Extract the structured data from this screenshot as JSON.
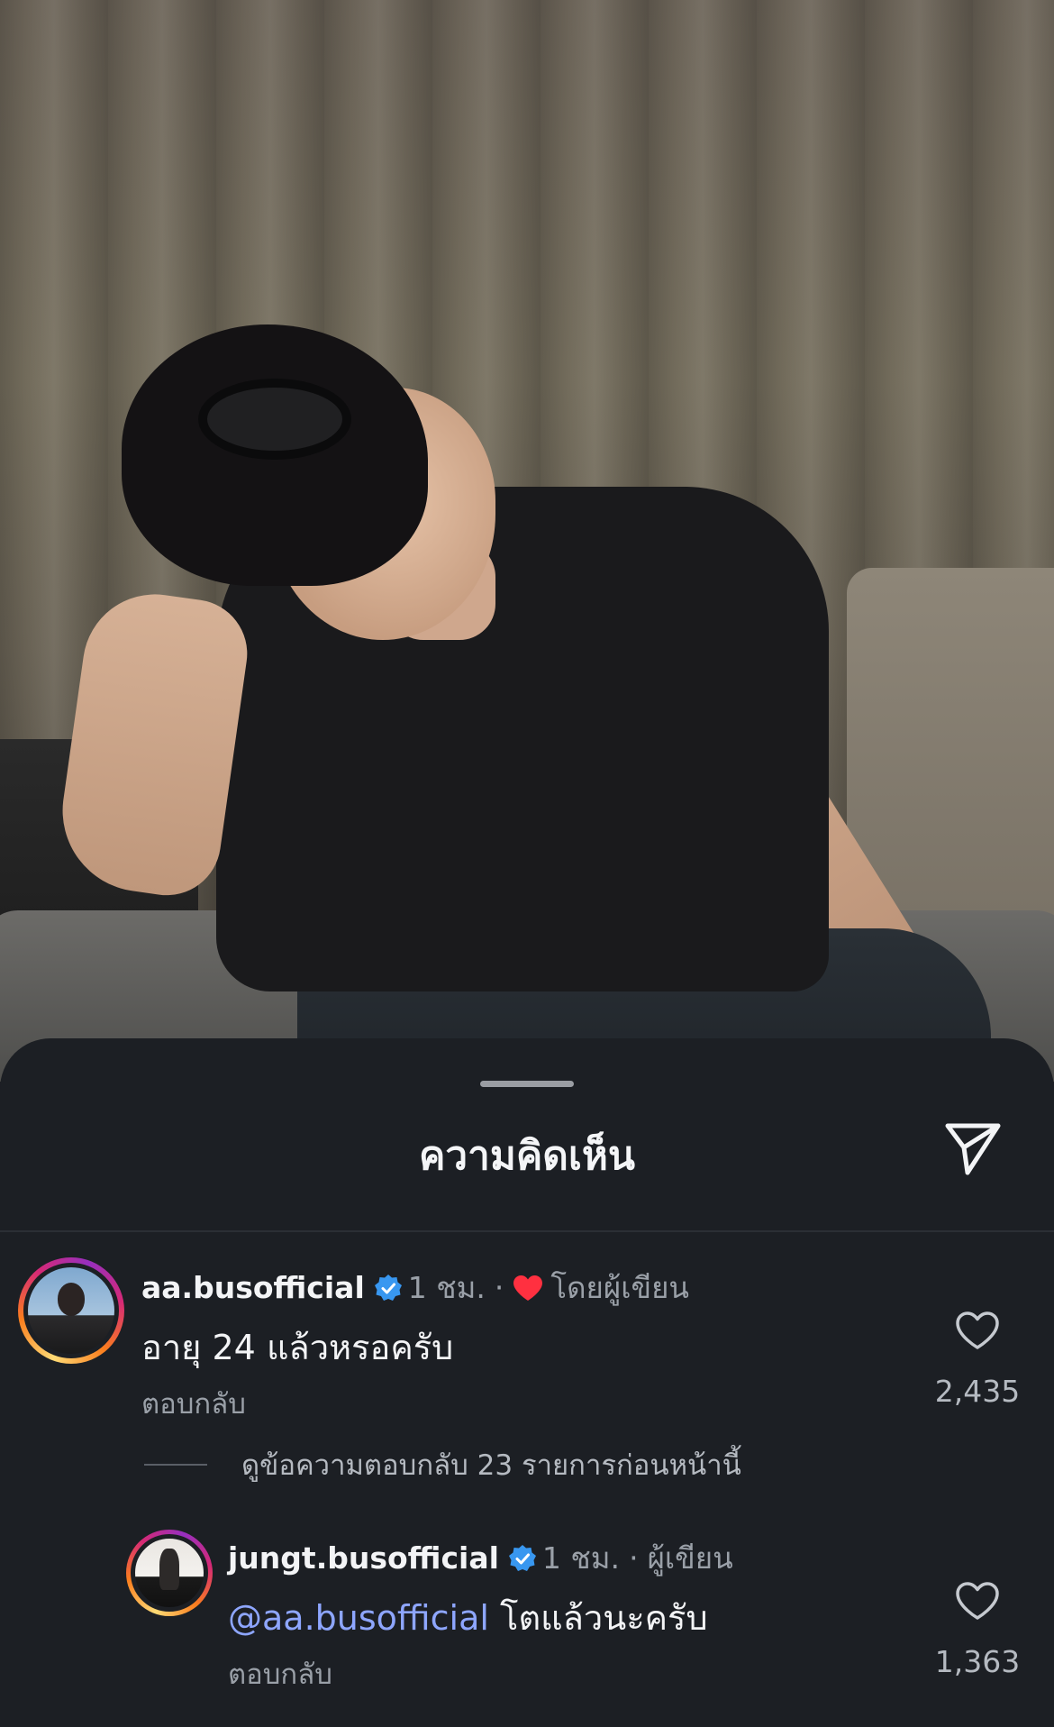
{
  "sheet": {
    "title": "ความคิดเห็น",
    "share_icon": "send-paper-plane-icon"
  },
  "comments": [
    {
      "username": "aa.busofficial",
      "verified": true,
      "time": "1 ชม.",
      "separator": "·",
      "liked_by_author_label": "โดยผู้เขียน",
      "text": "อายุ 24 แล้วหรอครับ",
      "reply_label": "ตอบกลับ",
      "like_count": "2,435",
      "view_replies_label": "ดูข้อความตอบกลับ 23 รายการก่อนหน้านี้"
    },
    {
      "username": "jungt.busofficial",
      "verified": true,
      "time": "1 ชม.",
      "separator": "·",
      "author_label": "ผู้เขียน",
      "mention": "@aa.busofficial",
      "text": "โตแล้วนะครับ",
      "reply_label": "ตอบกลับ",
      "like_count": "1,363"
    }
  ],
  "colors": {
    "background": "#1c1f24",
    "verified_blue": "#3897f0",
    "mention_blue": "#8ea6ff",
    "heart_red": "#ff3040",
    "muted_text": "#9aa0a8"
  }
}
